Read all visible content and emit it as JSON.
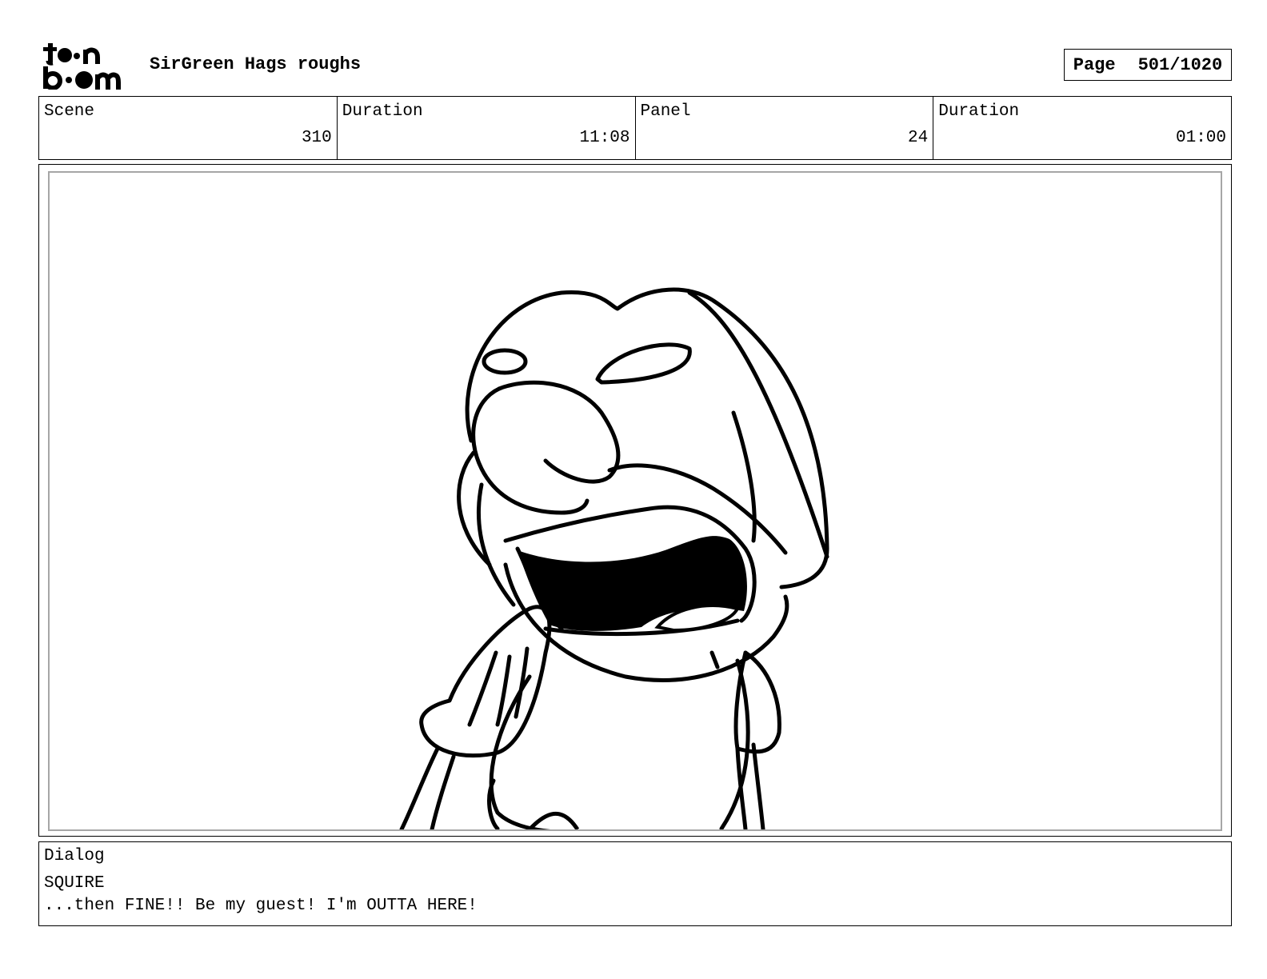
{
  "header": {
    "logo_text": "toon boom",
    "title": "SirGreen Hags roughs",
    "page_label": "Page",
    "page_value": "501/1020"
  },
  "info": {
    "scene_label": "Scene",
    "scene_value": "310",
    "scene_duration_label": "Duration",
    "scene_duration_value": "11:08",
    "panel_label": "Panel",
    "panel_value": "24",
    "panel_duration_label": "Duration",
    "panel_duration_value": "01:00"
  },
  "dialog": {
    "label": "Dialog",
    "speaker": "SQUIRE",
    "line": "...then FINE!! Be my guest! I'm OUTTA HERE!"
  }
}
